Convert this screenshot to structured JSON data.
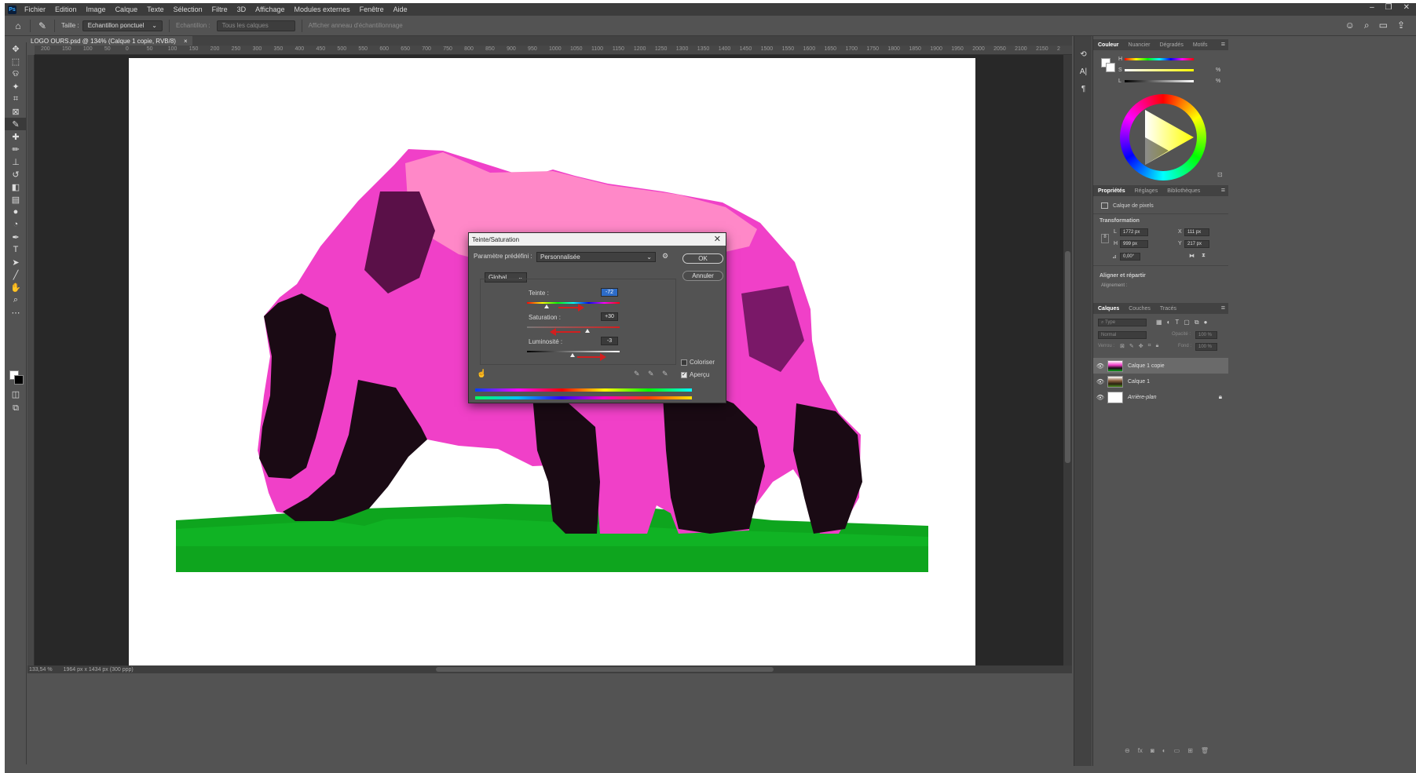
{
  "menu": {
    "items": [
      "Fichier",
      "Edition",
      "Image",
      "Calque",
      "Texte",
      "Sélection",
      "Filtre",
      "3D",
      "Affichage",
      "Modules externes",
      "Fenêtre",
      "Aide"
    ],
    "window_controls": [
      "–",
      "❐",
      "✕"
    ]
  },
  "options_bar": {
    "size_label": "Taille :",
    "sample_value": "Echantillon ponctuel",
    "sample_label": "Echantillon :",
    "sample_layers": "Tous les calques",
    "show_ring": "Afficher anneau d'échantillonnage"
  },
  "document": {
    "tab_title": "LOGO OURS.psd @ 134% (Calque 1 copie, RVB/8)",
    "tab_close": "×",
    "ruler_labels": [
      "200",
      "150",
      "100",
      "50",
      "0",
      "50",
      "100",
      "150",
      "200",
      "250",
      "300",
      "350",
      "400",
      "450",
      "500",
      "550",
      "600",
      "650",
      "700",
      "750",
      "800",
      "850",
      "900",
      "950",
      "1000",
      "1050",
      "1100",
      "1150",
      "1200",
      "1250",
      "1300",
      "1350",
      "1400",
      "1450",
      "1500",
      "1550",
      "1600",
      "1650",
      "1700",
      "1750",
      "1800",
      "1850",
      "1900",
      "1950",
      "2000",
      "2050",
      "2100",
      "2150",
      "2"
    ],
    "status_zoom": "133,54 %",
    "status_size": "1964 px x 1434 px (300 ppp)"
  },
  "dialog": {
    "title": "Teinte/Saturation",
    "preset_label": "Paramètre prédéfini :",
    "preset_value": "Personnalisée",
    "ok_label": "OK",
    "cancel_label": "Annuler",
    "channel_value": "Global",
    "hue_label": "Teinte :",
    "hue_value": "-72",
    "saturation_label": "Saturation :",
    "saturation_value": "+30",
    "lightness_label": "Luminosité :",
    "lightness_value": "-3",
    "colorize_label": "Coloriser",
    "preview_label": "Aperçu",
    "colorize_checked": false,
    "preview_checked": true
  },
  "color_panel": {
    "tabs": [
      "Couleur",
      "Nuancier",
      "Dégradés",
      "Motifs"
    ],
    "slider_labels": [
      "H",
      "S",
      "L"
    ],
    "percent": "%"
  },
  "properties_panel": {
    "tabs": [
      "Propriétés",
      "Réglages",
      "Bibliothèques"
    ],
    "layer_type": "Calque de pixels",
    "transform_title": "Transformation",
    "w_label": "L",
    "w_value": "1772 px",
    "h_label": "H",
    "h_value": "999 px",
    "x_label": "X",
    "x_value": "111 px",
    "y_label": "Y",
    "y_value": "217 px",
    "angle_value": "0,00°",
    "align_title": "Aligner et répartir",
    "align_label": "Alignement :"
  },
  "layers_panel": {
    "tabs": [
      "Calques",
      "Couches",
      "Tracés"
    ],
    "search_placeholder": "Type",
    "blend_mode": "Normal",
    "opacity_label": "Opacité :",
    "opacity_value": "100 %",
    "lock_label": "Verrou :",
    "fill_label": "Fond :",
    "fill_value": "100 %",
    "layers": [
      {
        "name": "Calque 1 copie",
        "active": true
      },
      {
        "name": "Calque 1",
        "active": false
      },
      {
        "name": "Arrière-plan",
        "active": false,
        "locked": true
      }
    ]
  },
  "colors": {
    "chrome_dark": "#3c3c3c",
    "chrome": "#535353",
    "canvas_bg": "#282828",
    "bear_pink": "#f040c8",
    "bear_light": "#ff88c8",
    "bear_dark": "#1a0a14",
    "grass": "#0ea51e",
    "highlight": "#2d6cc8",
    "arrow_red": "#d21f1f"
  }
}
